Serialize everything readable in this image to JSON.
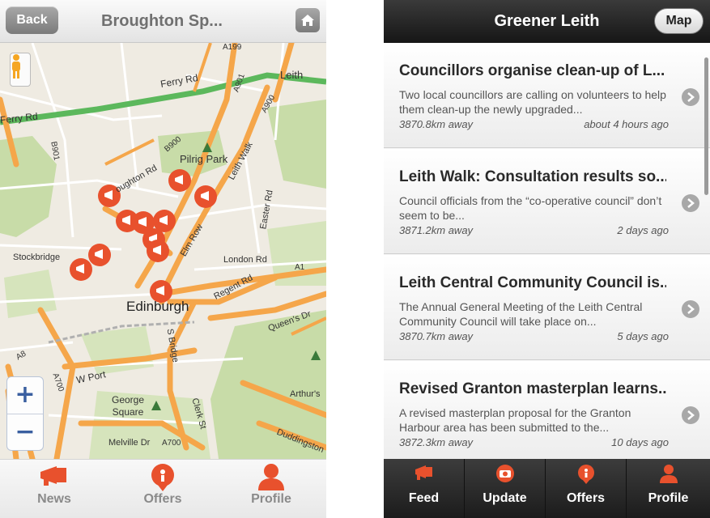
{
  "left": {
    "header": {
      "back_label": "Back",
      "title": "Broughton Sp..."
    },
    "map": {
      "labels": {
        "leith": "Leith",
        "ferry_rd_top": "Ferry Rd",
        "ferry_rd_left": "Ferry Rd",
        "b901": "B901",
        "b900": "B900",
        "a901": "A901",
        "a900": "A900",
        "a199": "A199",
        "pilrig_park": "Pilrig Park",
        "leith_walk": "Leith Walk",
        "broughton_rd": "oughton Rd",
        "easter_rd": "Easter Rd",
        "elm_row": "Elm Row",
        "stockbridge": "Stockbridge",
        "london_rd": "London Rd",
        "a1": "A1",
        "regent_rd": "Regent Rd",
        "edinburgh": "Edinburgh",
        "queens_dr": "Queen's Dr",
        "s_bridge": "S Bridge",
        "w_port": "W Port",
        "a8": "A8",
        "a700": "A700",
        "george_square": "George\nSquare",
        "clerk_st": "Clerk St",
        "arthurs": "Arthur's",
        "melville_dr": "Melville Dr",
        "a700_bottom": "A700",
        "duddingston": "Duddingston"
      },
      "zoom_in": "+",
      "zoom_out": "−"
    },
    "tabs": [
      {
        "label": "News"
      },
      {
        "label": "Offers"
      },
      {
        "label": "Profile"
      }
    ]
  },
  "right": {
    "header": {
      "title": "Greener Leith",
      "map_label": "Map"
    },
    "items": [
      {
        "title": "Councillors organise clean-up of L...",
        "desc": "Two local councillors are calling on volunteers to help them clean-up the newly upgraded...",
        "distance": "3870.8km away",
        "time": "about 4 hours ago"
      },
      {
        "title": "Leith Walk: Consultation results so...",
        "desc": "Council officials from the “co-operative council” don’t seem to be...",
        "distance": "3871.2km away",
        "time": "2 days ago"
      },
      {
        "title": "Leith Central Community Council is...",
        "desc": "The Annual General Meeting of the Leith Central Community Council will take place on...",
        "distance": "3870.7km away",
        "time": "5 days ago"
      },
      {
        "title": "Revised Granton masterplan learns...",
        "desc": "A revised masterplan proposal for the Granton Harbour area has been submitted to the...",
        "distance": "3872.3km away",
        "time": "10 days ago"
      }
    ],
    "tabs": [
      {
        "label": "Feed"
      },
      {
        "label": "Update"
      },
      {
        "label": "Offers"
      },
      {
        "label": "Profile"
      }
    ]
  },
  "colors": {
    "accent": "#e8512d",
    "road_major": "#f5a64a",
    "road_green": "#5cb85c",
    "park": "#c8dca8"
  }
}
